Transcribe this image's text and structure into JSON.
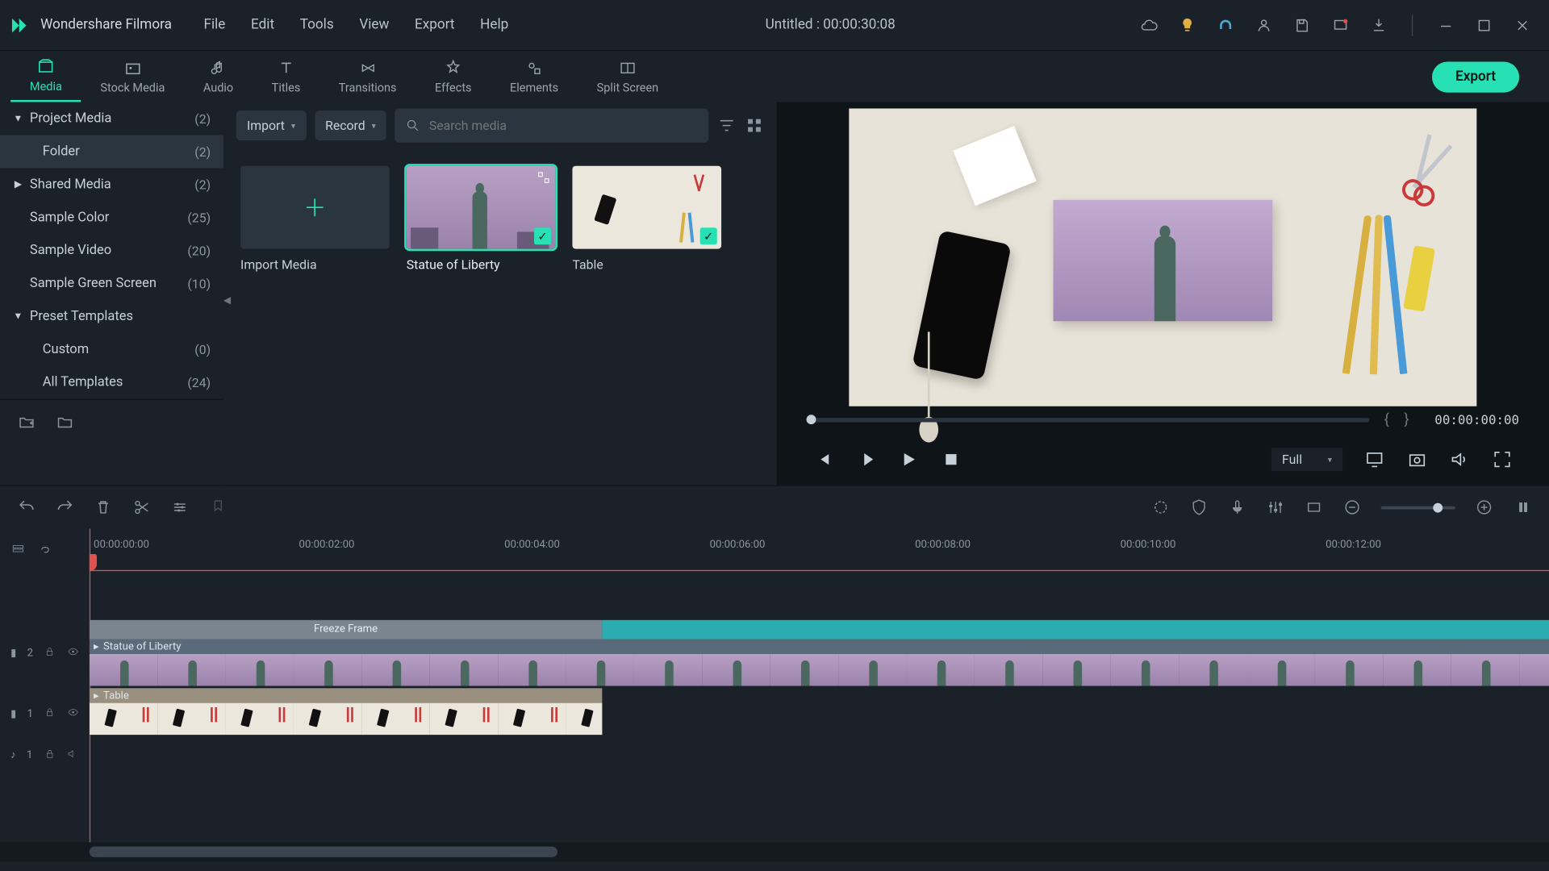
{
  "app": {
    "name": "Wondershare Filmora"
  },
  "titlebar": {
    "menu": [
      "File",
      "Edit",
      "Tools",
      "View",
      "Export",
      "Help"
    ],
    "center": "Untitled : 00:00:30:08"
  },
  "tabs": {
    "items": [
      "Media",
      "Stock Media",
      "Audio",
      "Titles",
      "Transitions",
      "Effects",
      "Elements",
      "Split Screen"
    ],
    "active_index": 0,
    "export": "Export"
  },
  "sidebar": {
    "items": [
      {
        "label": "Project Media",
        "count": "(2)",
        "arrow": "▼"
      },
      {
        "label": "Folder",
        "count": "(2)",
        "indent": true,
        "selected": true
      },
      {
        "label": "Shared Media",
        "count": "(2)",
        "arrow": "▶"
      },
      {
        "label": "Sample Color",
        "count": "(25)"
      },
      {
        "label": "Sample Video",
        "count": "(20)"
      },
      {
        "label": "Sample Green Screen",
        "count": "(10)"
      },
      {
        "label": "Preset Templates",
        "count": "",
        "arrow": "▼"
      },
      {
        "label": "Custom",
        "count": "(0)",
        "indent": true
      },
      {
        "label": "All Templates",
        "count": "(24)",
        "indent": true
      }
    ]
  },
  "mediaBrowser": {
    "import": "Import",
    "record": "Record",
    "search_placeholder": "Search media",
    "cards": [
      {
        "label": "Import Media",
        "kind": "import"
      },
      {
        "label": "Statue of Liberty",
        "kind": "liberty",
        "selected": true,
        "checked": true
      },
      {
        "label": "Table",
        "kind": "table",
        "checked": true
      }
    ]
  },
  "preview": {
    "timecode": "00:00:00:00",
    "quality": "Full"
  },
  "timeline": {
    "ruler": [
      "00:00:00:00",
      "00:00:02:00",
      "00:00:04:00",
      "00:00:06:00",
      "00:00:08:00",
      "00:00:10:00",
      "00:00:12:00"
    ],
    "freeze_label": "Freeze Frame",
    "tracks": {
      "v2_label": "2",
      "v1_label": "1",
      "a1_label": "1"
    },
    "clips": {
      "v2": "Statue of Liberty",
      "v1": "Table"
    }
  }
}
